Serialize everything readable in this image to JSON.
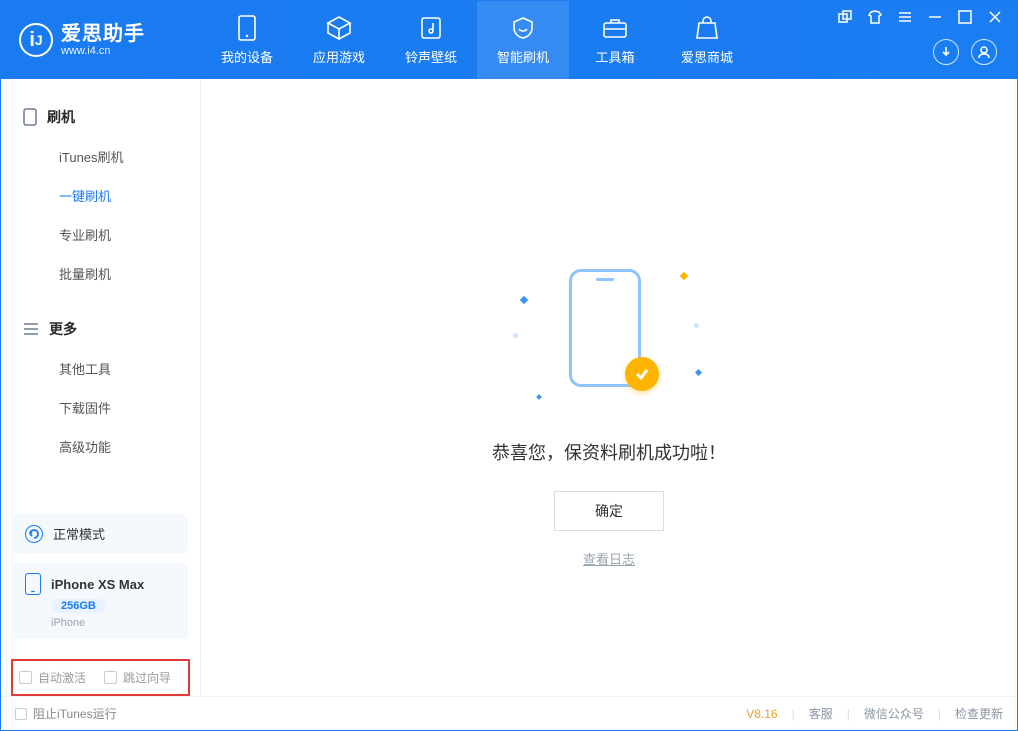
{
  "app": {
    "name": "爱思助手",
    "url": "www.i4.cn"
  },
  "nav": {
    "items": [
      {
        "label": "我的设备",
        "icon": "device"
      },
      {
        "label": "应用游戏",
        "icon": "cube"
      },
      {
        "label": "铃声壁纸",
        "icon": "note"
      },
      {
        "label": "智能刷机",
        "icon": "shield",
        "active": true
      },
      {
        "label": "工具箱",
        "icon": "case"
      },
      {
        "label": "爱思商城",
        "icon": "bag"
      }
    ]
  },
  "sidebar": {
    "groups": [
      {
        "title": "刷机",
        "icon": "phone",
        "items": [
          {
            "label": "iTunes刷机"
          },
          {
            "label": "一键刷机",
            "active": true
          },
          {
            "label": "专业刷机"
          },
          {
            "label": "批量刷机"
          }
        ]
      },
      {
        "title": "更多",
        "icon": "menu",
        "items": [
          {
            "label": "其他工具"
          },
          {
            "label": "下载固件"
          },
          {
            "label": "高级功能"
          }
        ]
      }
    ],
    "mode_card": "正常模式",
    "device": {
      "name": "iPhone XS Max",
      "capacity": "256GB",
      "type": "iPhone"
    },
    "checks": {
      "auto_activate": "自动激活",
      "skip_guide": "跳过向导"
    }
  },
  "main": {
    "message": "恭喜您，保资料刷机成功啦！",
    "ok": "确定",
    "log": "查看日志"
  },
  "footer": {
    "block_itunes": "阻止iTunes运行",
    "version": "V8.16",
    "links": [
      "客服",
      "微信公众号",
      "检查更新"
    ]
  }
}
